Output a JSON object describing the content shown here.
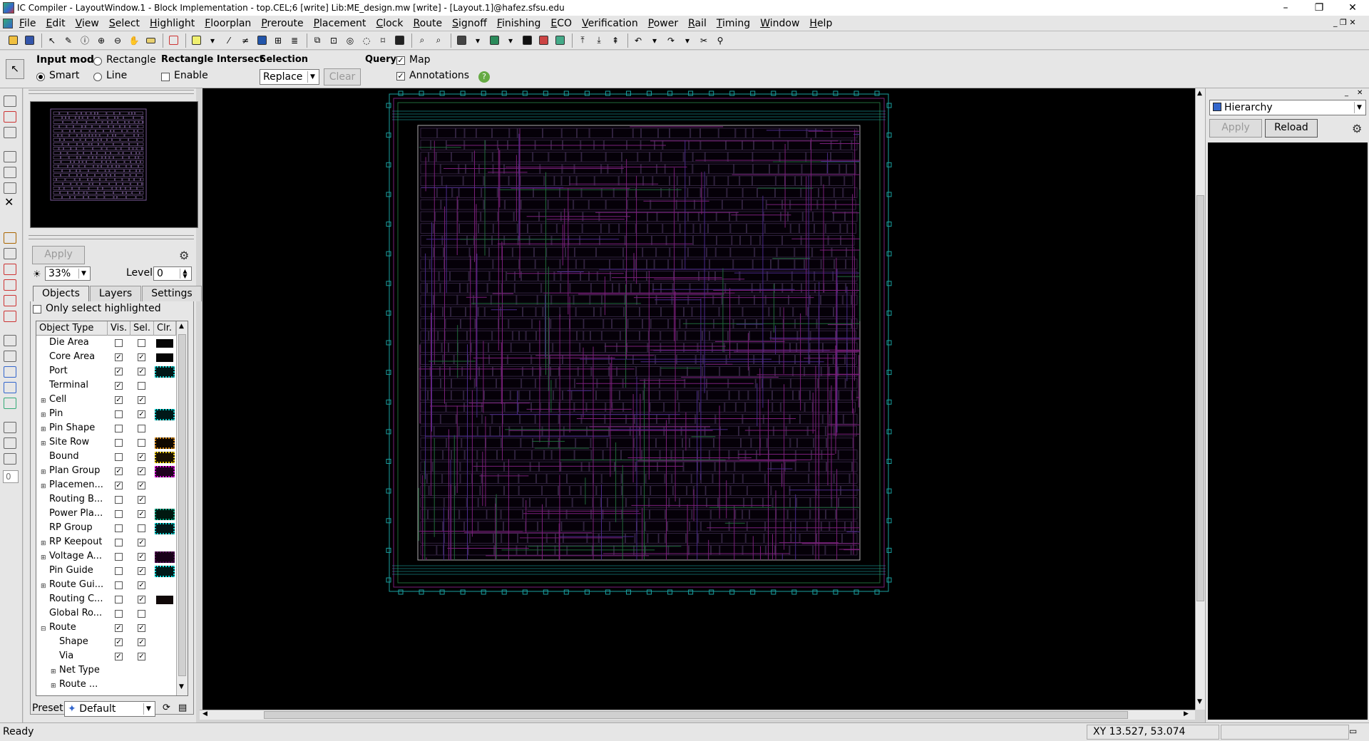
{
  "window": {
    "title": "IC Compiler - LayoutWindow.1 - Block Implementation - top.CEL;6 [write]   Lib:ME_design.mw [write] - [Layout.1]@hafez.sfsu.edu"
  },
  "menu": [
    "File",
    "Edit",
    "View",
    "Select",
    "Highlight",
    "Floorplan",
    "Preroute",
    "Placement",
    "Clock",
    "Route",
    "Signoff",
    "Finishing",
    "ECO",
    "Verification",
    "Power",
    "Rail",
    "Timing",
    "Window",
    "Help"
  ],
  "options": {
    "input_mode_label": "Input mode",
    "rectangle": "Rectangle",
    "smart": "Smart",
    "line": "Line",
    "rect_intersect_label": "Rectangle Intersect",
    "enable": "Enable",
    "selection_label": "Selection",
    "selection_value": "Replace",
    "clear": "Clear",
    "query_label": "Query",
    "map": "Map",
    "annotations": "Annotations",
    "help_glyph": "?"
  },
  "leftpanel": {
    "apply": "Apply",
    "zoom_value": "33%",
    "level_label": "Level",
    "level_value": "0",
    "tabs": [
      "Objects",
      "Layers",
      "Settings"
    ],
    "only_select_highlighted": "Only select highlighted",
    "columns": [
      "Object Type",
      "Vis.",
      "Sel.",
      "Clr."
    ],
    "rows": [
      {
        "name": "Die Area",
        "exp": "",
        "indent": 0,
        "vis": false,
        "sel": false,
        "swatch": "#050505",
        "sw_border": "#ffffff"
      },
      {
        "name": "Core Area",
        "exp": "",
        "indent": 0,
        "vis": true,
        "sel": true,
        "swatch": "#050505",
        "sw_border": "#ffffff"
      },
      {
        "name": "Port",
        "exp": "",
        "indent": 0,
        "vis": true,
        "sel": true,
        "swatch": "#001818",
        "sw_border": "#00c8c8"
      },
      {
        "name": "Terminal",
        "exp": "",
        "indent": 0,
        "vis": true,
        "sel": false,
        "swatch": "",
        "sw_border": ""
      },
      {
        "name": "Cell",
        "exp": "+",
        "indent": 0,
        "vis": true,
        "sel": true,
        "swatch": "",
        "sw_border": ""
      },
      {
        "name": "Pin",
        "exp": "+",
        "indent": 0,
        "vis": false,
        "sel": true,
        "swatch": "#001818",
        "sw_border": "#00c8c8"
      },
      {
        "name": "Pin Shape",
        "exp": "+",
        "indent": 0,
        "vis": false,
        "sel": false,
        "swatch": "",
        "sw_border": ""
      },
      {
        "name": "Site Row",
        "exp": "+",
        "indent": 0,
        "vis": false,
        "sel": false,
        "swatch": "#100800",
        "sw_border": "#d08000"
      },
      {
        "name": "Bound",
        "exp": "",
        "indent": 0,
        "vis": false,
        "sel": true,
        "swatch": "#181000",
        "sw_border": "#e0c000"
      },
      {
        "name": "Plan Group",
        "exp": "+",
        "indent": 0,
        "vis": true,
        "sel": true,
        "swatch": "#200020",
        "sw_border": "#d000d0"
      },
      {
        "name": "Placemen...",
        "exp": "+",
        "indent": 0,
        "vis": true,
        "sel": true,
        "swatch": "",
        "sw_border": ""
      },
      {
        "name": "Routing B...",
        "exp": "",
        "indent": 0,
        "vis": false,
        "sel": true,
        "swatch": "",
        "sw_border": ""
      },
      {
        "name": "Power Pla...",
        "exp": "",
        "indent": 0,
        "vis": false,
        "sel": true,
        "swatch": "#001810",
        "sw_border": "#00a080"
      },
      {
        "name": "RP Group",
        "exp": "",
        "indent": 0,
        "vis": false,
        "sel": false,
        "swatch": "#001818",
        "sw_border": "#00c8c8"
      },
      {
        "name": "RP Keepout",
        "exp": "+",
        "indent": 0,
        "vis": false,
        "sel": true,
        "swatch": "",
        "sw_border": ""
      },
      {
        "name": "Voltage A...",
        "exp": "+",
        "indent": 0,
        "vis": false,
        "sel": true,
        "swatch": "#180018",
        "sw_border": "#500050"
      },
      {
        "name": "Pin Guide",
        "exp": "",
        "indent": 0,
        "vis": false,
        "sel": true,
        "swatch": "#001818",
        "sw_border": "#00d8d8"
      },
      {
        "name": "Route Gui...",
        "exp": "+",
        "indent": 0,
        "vis": false,
        "sel": true,
        "swatch": "",
        "sw_border": ""
      },
      {
        "name": "Routing C...",
        "exp": "",
        "indent": 0,
        "vis": false,
        "sel": true,
        "swatch": "#100808",
        "sw_border": "#ffffff"
      },
      {
        "name": "Global Ro...",
        "exp": "",
        "indent": 0,
        "vis": false,
        "sel": false,
        "swatch": "",
        "sw_border": ""
      },
      {
        "name": "Route",
        "exp": "-",
        "indent": 0,
        "vis": true,
        "sel": true,
        "swatch": "",
        "sw_border": ""
      },
      {
        "name": "Shape",
        "exp": "",
        "indent": 1,
        "vis": true,
        "sel": true,
        "swatch": "",
        "sw_border": ""
      },
      {
        "name": "Via",
        "exp": "",
        "indent": 1,
        "vis": true,
        "sel": true,
        "swatch": "",
        "sw_border": ""
      },
      {
        "name": "Net Type",
        "exp": "+",
        "indent": 1,
        "vis": null,
        "sel": null,
        "swatch": "",
        "sw_border": ""
      },
      {
        "name": "Route ...",
        "exp": "+",
        "indent": 1,
        "vis": null,
        "sel": null,
        "swatch": "",
        "sw_border": ""
      }
    ],
    "preset_label": "Preset",
    "preset_value": "Default"
  },
  "rightpanel": {
    "view_value": "Hierarchy",
    "apply": "Apply",
    "reload": "Reload"
  },
  "status": {
    "text": "Ready",
    "coords": "XY 13.527, 53.074"
  },
  "colors": {
    "canvas_bg": "#000000",
    "route_magenta": "#7a1f7a",
    "route_purple": "#4a2a8a",
    "route_green": "#1f6a3a",
    "port_cyan": "#1aa0a0"
  }
}
